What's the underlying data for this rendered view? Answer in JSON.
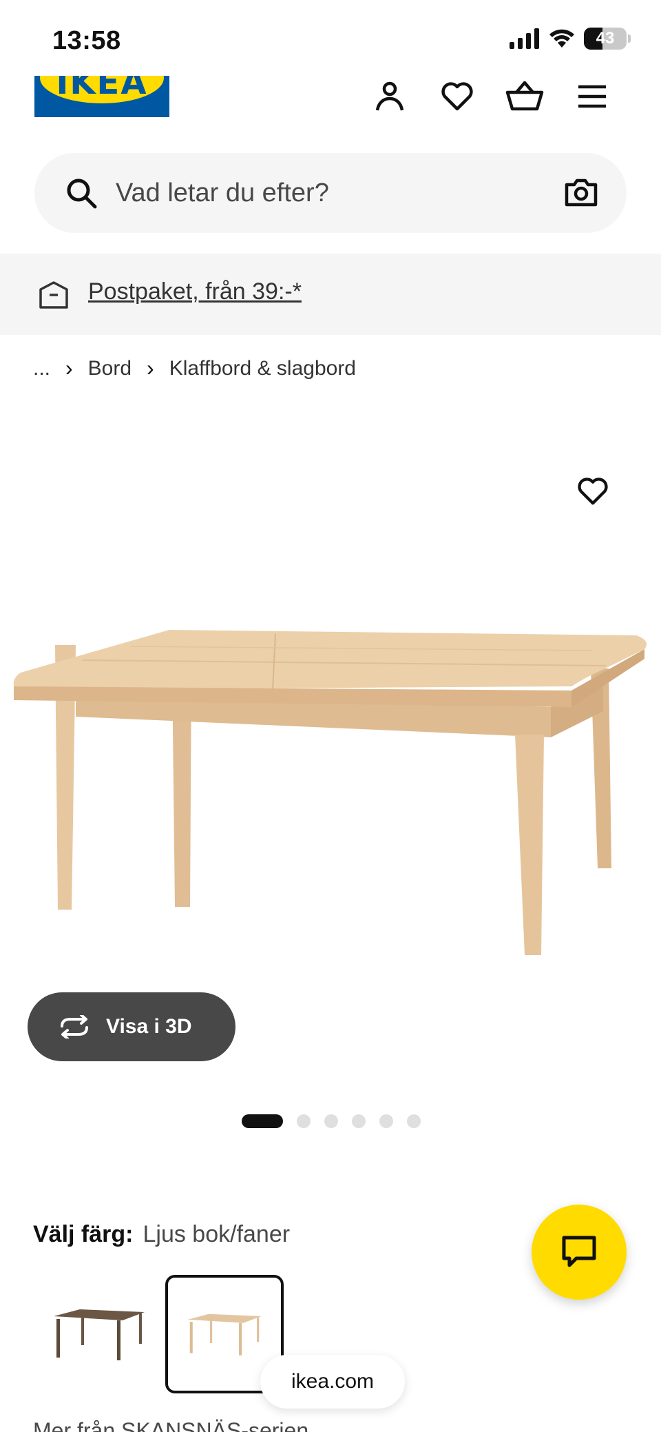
{
  "status_bar": {
    "time": "13:58",
    "battery": "43",
    "battery_level": 0.43
  },
  "header": {
    "logo_text": "IKEA",
    "icons": [
      "profile-icon",
      "heart-icon",
      "cart-icon",
      "menu-icon"
    ]
  },
  "search": {
    "placeholder": "Vad letar du efter?"
  },
  "banner": {
    "link_text": "Postpaket, från 39:-*"
  },
  "breadcrumb": {
    "ellipsis": "...",
    "items": [
      "Bord",
      "Klaffbord & slagbord"
    ]
  },
  "product": {
    "view_3d_label": "Visa i 3D",
    "image_count": 6,
    "active_image": 1
  },
  "color_picker": {
    "label": "Välj färg:",
    "selected_value": "Ljus bok/faner",
    "swatches": [
      {
        "name": "dark",
        "color": "#6b5744",
        "selected": false
      },
      {
        "name": "light",
        "color": "#e3c6a0",
        "selected": true
      }
    ]
  },
  "footer": {
    "url": "ikea.com",
    "series_text": "Mer från SKANSNÄS-serien"
  },
  "colors": {
    "brand_blue": "#0058a3",
    "brand_yellow": "#ffdb00",
    "wood": "#e9cba4"
  }
}
